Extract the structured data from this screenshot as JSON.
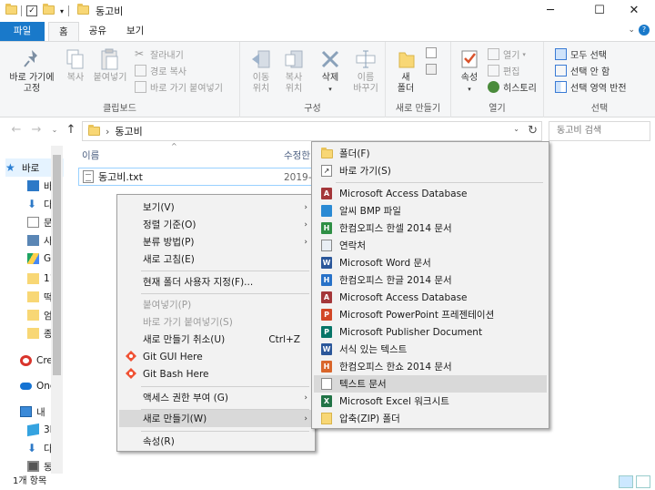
{
  "window": {
    "title": "동고비",
    "controls": {
      "minimize": "─",
      "maximize": "☐",
      "close": "✕"
    }
  },
  "ribbon": {
    "tabs": [
      {
        "label": "파일"
      },
      {
        "label": "홈"
      },
      {
        "label": "공유"
      },
      {
        "label": "보기"
      }
    ],
    "clipboard": {
      "pin_label_1": "바로 가기에",
      "pin_label_2": "고정",
      "copy_label": "복사",
      "paste_label": "붙여넣기",
      "cut_label": "잘라내기",
      "copy_path_label": "경로 복사",
      "paste_shortcut_label": "바로 가기 붙여넣기",
      "group_label": "클립보드"
    },
    "organize": {
      "move_to_1": "이동",
      "move_to_2": "위치",
      "copy_to_1": "복사",
      "copy_to_2": "위치",
      "delete_label": "삭제",
      "rename_1": "이름",
      "rename_2": "바꾸기",
      "group_label": "구성"
    },
    "new": {
      "new_folder_1": "새",
      "new_folder_2": "폴더",
      "group_label": "새로 만들기"
    },
    "open": {
      "properties_label": "속성",
      "open_label": "열기",
      "edit_label": "편집",
      "history_label": "히스토리",
      "group_label": "열기"
    },
    "select": {
      "select_all": "모두 선택",
      "select_none": "선택 안 함",
      "invert": "선택 영역 반전",
      "group_label": "선택"
    }
  },
  "address": {
    "path": "동고비",
    "search_placeholder": "동고비 검색"
  },
  "navpane": {
    "items": [
      {
        "label": "바로",
        "icon": "star-icon"
      },
      {
        "label": "바",
        "icon": "desktop-icon"
      },
      {
        "label": "다",
        "icon": "download-icon"
      },
      {
        "label": "문",
        "icon": "document-icon"
      },
      {
        "label": "사",
        "icon": "pictures-icon"
      },
      {
        "label": "Go",
        "icon": "google-drive-icon"
      },
      {
        "label": "11",
        "icon": "folder-icon"
      },
      {
        "label": "떡",
        "icon": "folder-icon"
      },
      {
        "label": "엄",
        "icon": "folder-icon"
      },
      {
        "label": "종",
        "icon": "folder-icon"
      },
      {
        "label": "Cre",
        "icon": "creative-cloud-icon"
      },
      {
        "label": "One",
        "icon": "onedrive-icon"
      },
      {
        "label": "내",
        "icon": "this-pc-icon"
      },
      {
        "label": "3I",
        "icon": "3d-objects-icon"
      },
      {
        "label": "다",
        "icon": "download-icon"
      },
      {
        "label": "동",
        "icon": "video-icon"
      }
    ]
  },
  "filelist": {
    "col_name": "이름",
    "col_date": "수정한",
    "file_name": "동고비.txt",
    "file_date": "2019-0"
  },
  "status": {
    "count": "1개 항목"
  },
  "context_menu": {
    "items": [
      {
        "label": "보기(V)",
        "arrow": "›"
      },
      {
        "label": "정렬 기준(O)",
        "arrow": "›"
      },
      {
        "label": "분류 방법(P)",
        "arrow": "›"
      },
      {
        "label": "새로 고침(E)"
      },
      {
        "label": "현재 폴더 사용자 지정(F)..."
      },
      {
        "label": "붙여넣기(P)"
      },
      {
        "label": "바로 가기 붙여넣기(S)"
      },
      {
        "label": "새로 만들기 취소(U)",
        "shortcut": "Ctrl+Z"
      },
      {
        "label": "Git GUI Here"
      },
      {
        "label": "Git Bash Here"
      },
      {
        "label": "액세스 권한 부여 (G)",
        "arrow": "›"
      },
      {
        "label": "새로 만들기(W)",
        "arrow": "›"
      },
      {
        "label": "속성(R)"
      }
    ]
  },
  "new_submenu": {
    "items": [
      {
        "label": "폴더(F)"
      },
      {
        "label": "바로 가기(S)"
      },
      {
        "label": "Microsoft Access Database"
      },
      {
        "label": "알씨 BMP 파일"
      },
      {
        "label": "한컴오피스 한셀 2014 문서"
      },
      {
        "label": "연락처"
      },
      {
        "label": "Microsoft Word 문서"
      },
      {
        "label": "한컴오피스 한글 2014 문서"
      },
      {
        "label": "Microsoft Access Database"
      },
      {
        "label": "Microsoft PowerPoint 프레젠테이션"
      },
      {
        "label": "Microsoft Publisher Document"
      },
      {
        "label": "서식 있는 텍스트"
      },
      {
        "label": "한컴오피스 한쇼 2014 문서"
      },
      {
        "label": "텍스트 문서"
      },
      {
        "label": "Microsoft Excel 워크시트"
      },
      {
        "label": "압축(ZIP) 폴더"
      }
    ]
  },
  "colors": {
    "file_tab": "#1979ca",
    "ribbon_bg": "#f5f6f7",
    "menu_bg": "#f2f2f2",
    "menu_highlight": "#d9d9d9",
    "selection_border": "#99d1ff"
  }
}
